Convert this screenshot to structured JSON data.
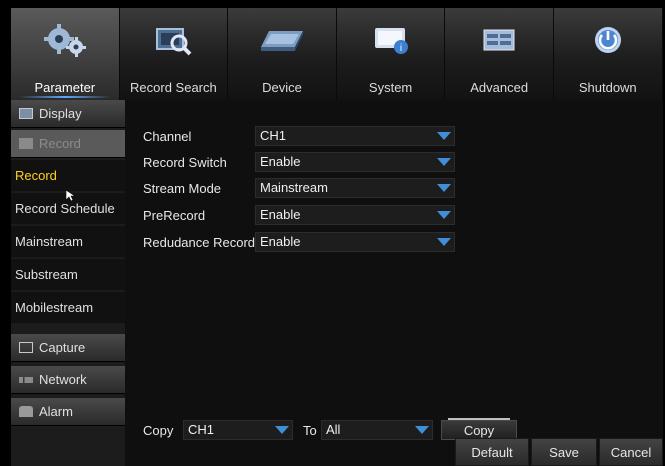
{
  "top_tabs": [
    {
      "label": "Parameter",
      "icon": "gears-icon"
    },
    {
      "label": "Record Search",
      "icon": "record-search-icon"
    },
    {
      "label": "Device",
      "icon": "hard-drive-icon"
    },
    {
      "label": "System",
      "icon": "system-monitor-icon"
    },
    {
      "label": "Advanced",
      "icon": "advanced-panel-icon"
    },
    {
      "label": "Shutdown",
      "icon": "power-icon"
    }
  ],
  "active_tab": "Parameter",
  "sidebar": {
    "display": "Display",
    "record": "Record",
    "subitems": [
      "Record",
      "Record Schedule",
      "Mainstream",
      "Substream",
      "Mobilestream"
    ],
    "active_subitem": "Record",
    "capture": "Capture",
    "network": "Network",
    "alarm": "Alarm"
  },
  "fields": [
    {
      "label": "Channel",
      "value": "CH1"
    },
    {
      "label": "Record Switch",
      "value": "Enable"
    },
    {
      "label": "Stream Mode",
      "value": "Mainstream"
    },
    {
      "label": "PreRecord",
      "value": "Enable"
    },
    {
      "label": "Redudance Record",
      "value": "Enable"
    }
  ],
  "copy_row": {
    "copy_label": "Copy",
    "from_value": "CH1",
    "to_label": "To",
    "to_value": "All",
    "copy_button": "Copy"
  },
  "footer": {
    "default": "Default",
    "save": "Save",
    "cancel": "Cancel"
  },
  "colors": {
    "accent_blue": "#3f8ed8",
    "active_text": "#ffd21e"
  }
}
